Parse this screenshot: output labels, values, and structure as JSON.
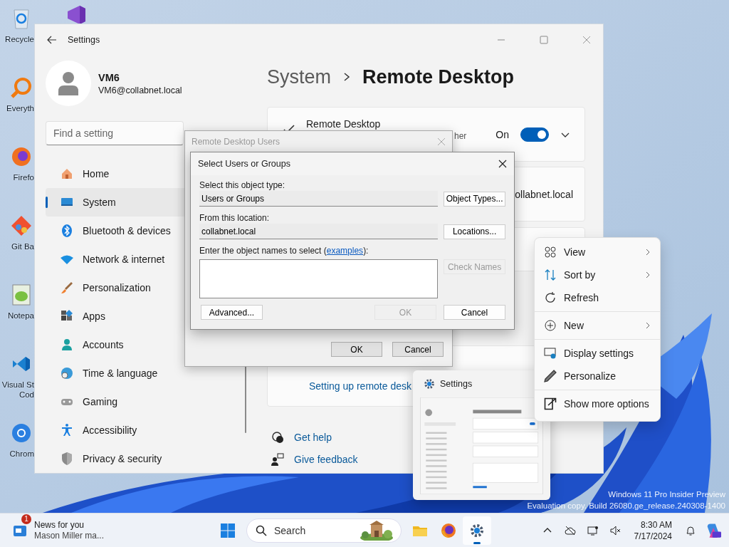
{
  "desktop": {
    "icons": [
      {
        "label": "Recycle"
      },
      {
        "label": "Everyth"
      },
      {
        "label": "Firefo"
      },
      {
        "label": "Git Ba"
      },
      {
        "label": "Notepa"
      },
      {
        "label": "Visual St\nCod"
      },
      {
        "label": "Chrom"
      }
    ]
  },
  "settings": {
    "title": "Settings",
    "user": {
      "name": "VM6",
      "email": "VM6@collabnet.local"
    },
    "search": {
      "placeholder": "Find a setting"
    },
    "nav": [
      {
        "label": "Home",
        "selected": false
      },
      {
        "label": "System",
        "selected": true
      },
      {
        "label": "Bluetooth & devices",
        "selected": false
      },
      {
        "label": "Network & internet",
        "selected": false
      },
      {
        "label": "Personalization",
        "selected": false
      },
      {
        "label": "Apps",
        "selected": false
      },
      {
        "label": "Accounts",
        "selected": false
      },
      {
        "label": "Time & language",
        "selected": false
      },
      {
        "label": "Gaming",
        "selected": false
      },
      {
        "label": "Accessibility",
        "selected": false
      },
      {
        "label": "Privacy & security",
        "selected": false
      }
    ],
    "breadcrumb": {
      "parent": "System",
      "current": "Remote Desktop"
    },
    "remote_desktop": {
      "title": "Remote Desktop",
      "subtitle": "her",
      "state": "On",
      "on": true
    },
    "pc_name": {
      "value": "ollabnet.local"
    },
    "link": "Setting up remote desk",
    "help_links": [
      "Get help",
      "Give feedback"
    ]
  },
  "users_dialog": {
    "title": "Remote Desktop Users",
    "active": false,
    "buttons": [
      "OK",
      "Cancel"
    ]
  },
  "select_dialog": {
    "title": "Select Users or Groups",
    "object_type": {
      "label": "Select this object type:",
      "value": "Users or Groups",
      "button": "Object Types..."
    },
    "location": {
      "label": "From this location:",
      "value": "collabnet.local",
      "button": "Locations..."
    },
    "names": {
      "label_before": "Enter the object names to select (",
      "link": "examples",
      "label_after": "):",
      "check_button": {
        "label": "Check Names",
        "disabled": true
      }
    },
    "buttons": [
      {
        "label": "Advanced...",
        "disabled": false
      },
      {
        "label": "OK",
        "disabled": true
      },
      {
        "label": "Cancel",
        "disabled": false
      }
    ]
  },
  "context_menu": {
    "groups": [
      [
        {
          "label": "View",
          "submenu": true
        },
        {
          "label": "Sort by",
          "submenu": true
        },
        {
          "label": "Refresh",
          "submenu": false
        }
      ],
      [
        {
          "label": "New",
          "submenu": true
        }
      ],
      [
        {
          "label": "Display settings",
          "submenu": false
        },
        {
          "label": "Personalize",
          "submenu": false
        }
      ],
      [
        {
          "label": "Show more options",
          "submenu": false
        }
      ]
    ]
  },
  "thumbnail": {
    "title": "Settings"
  },
  "watermark": {
    "lines": [
      "Windows 11 Pro Insider Preview",
      "Evaluation copy. Build 26080.ge_release.240308-1400"
    ]
  },
  "taskbar": {
    "news": {
      "badge": "1",
      "title": "News for you",
      "subtitle": "Mason Miller ma..."
    },
    "search": {
      "placeholder": "Search"
    },
    "apps": [
      {
        "selected": false
      },
      {
        "selected": false
      },
      {
        "selected": true
      }
    ],
    "clock": {
      "time": "8:30 AM",
      "date": "7/17/2024"
    }
  }
}
